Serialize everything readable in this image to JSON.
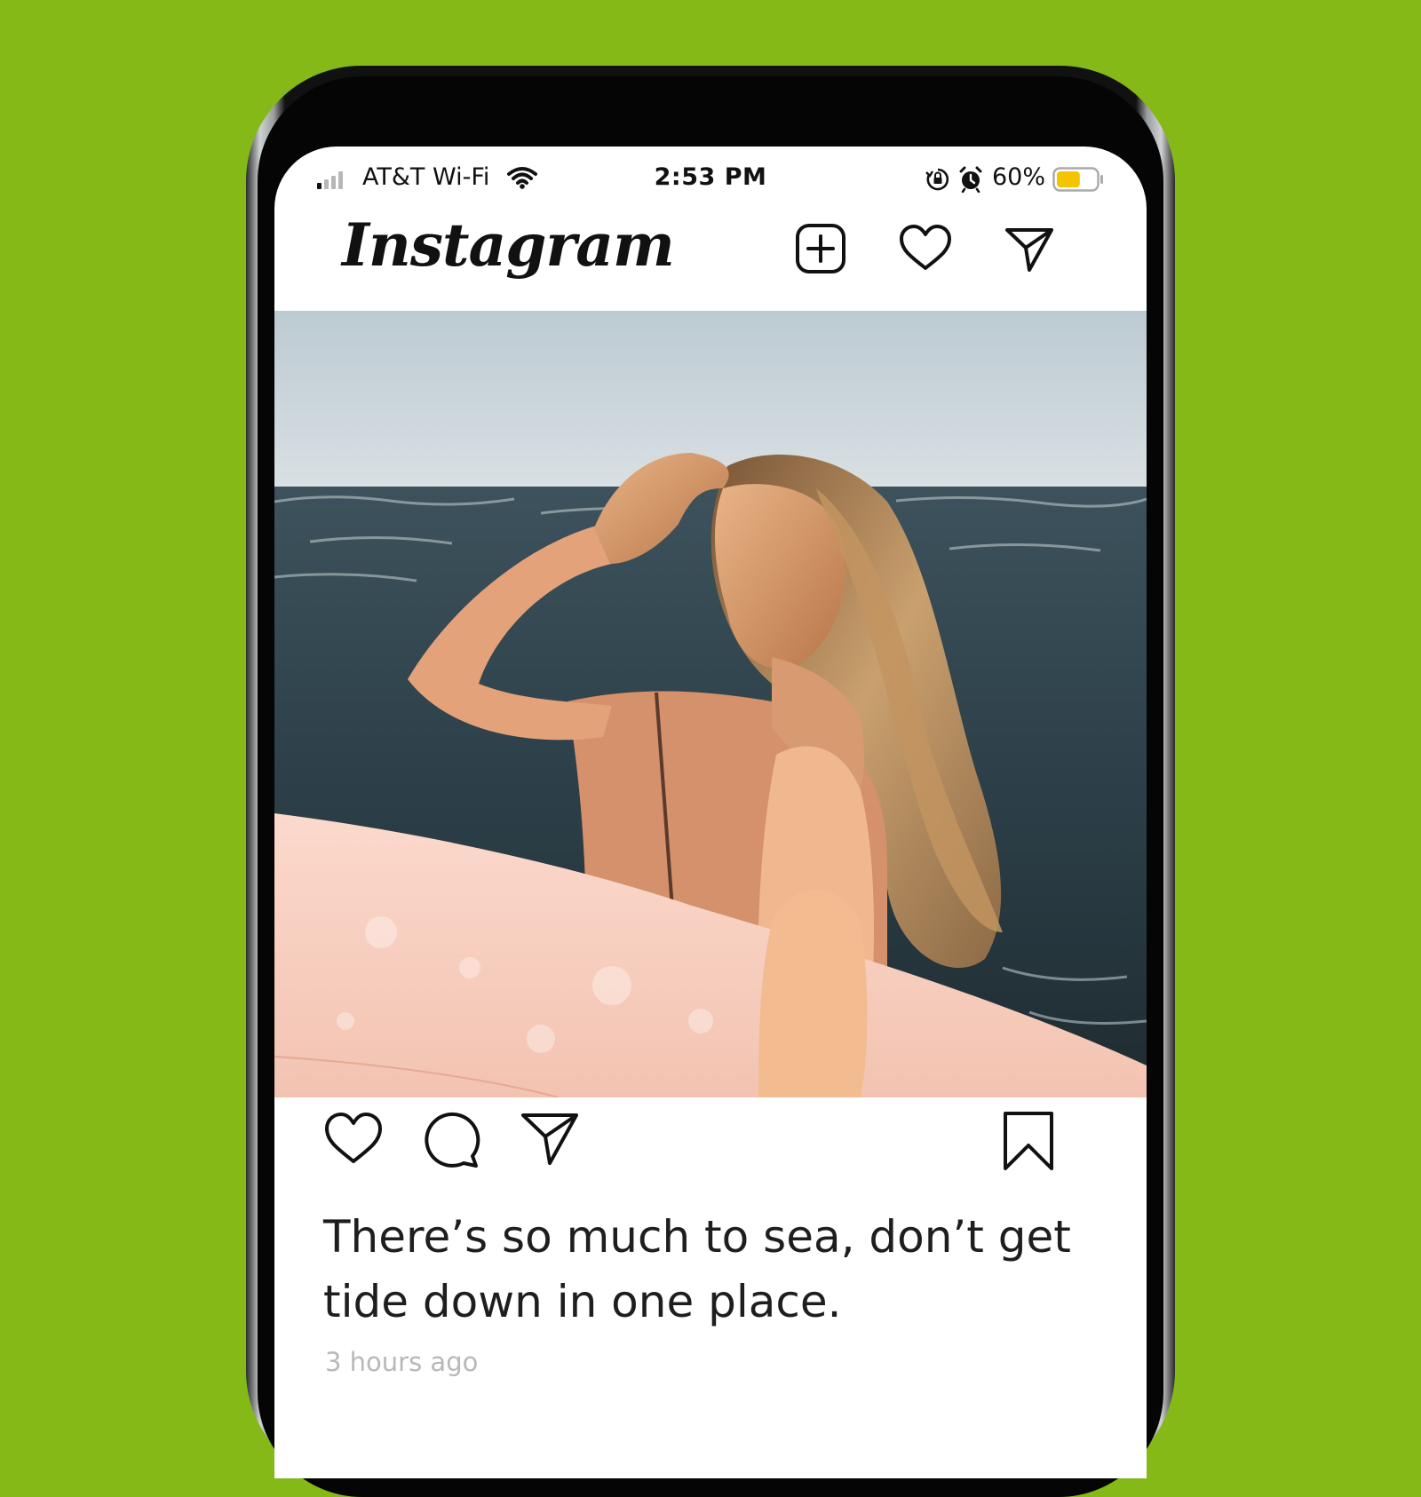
{
  "status_bar": {
    "carrier": "AT&T Wi-Fi",
    "time": "2:53 PM",
    "battery_percent": "60%",
    "battery_level": 0.6,
    "battery_color": "#f5c400",
    "icons": [
      "signal-icon",
      "wifi-icon",
      "rotation-lock-icon",
      "alarm-icon",
      "battery-icon"
    ]
  },
  "header": {
    "logo": "Instagram",
    "icons": [
      "add-post-icon",
      "heart-icon",
      "direct-message-icon"
    ]
  },
  "post": {
    "image_subject": "photo-woman-with-surfboard-at-sea",
    "actions": [
      "like-icon",
      "comment-icon",
      "share-icon",
      "bookmark-icon"
    ],
    "caption": "There’s so much to sea, don’t get tide down in one place.",
    "timestamp": "3 hours ago"
  },
  "colors": {
    "background": "#84b918",
    "screen": "#ffffff",
    "text": "#1e1e1e",
    "muted": "#b8b8b8"
  }
}
